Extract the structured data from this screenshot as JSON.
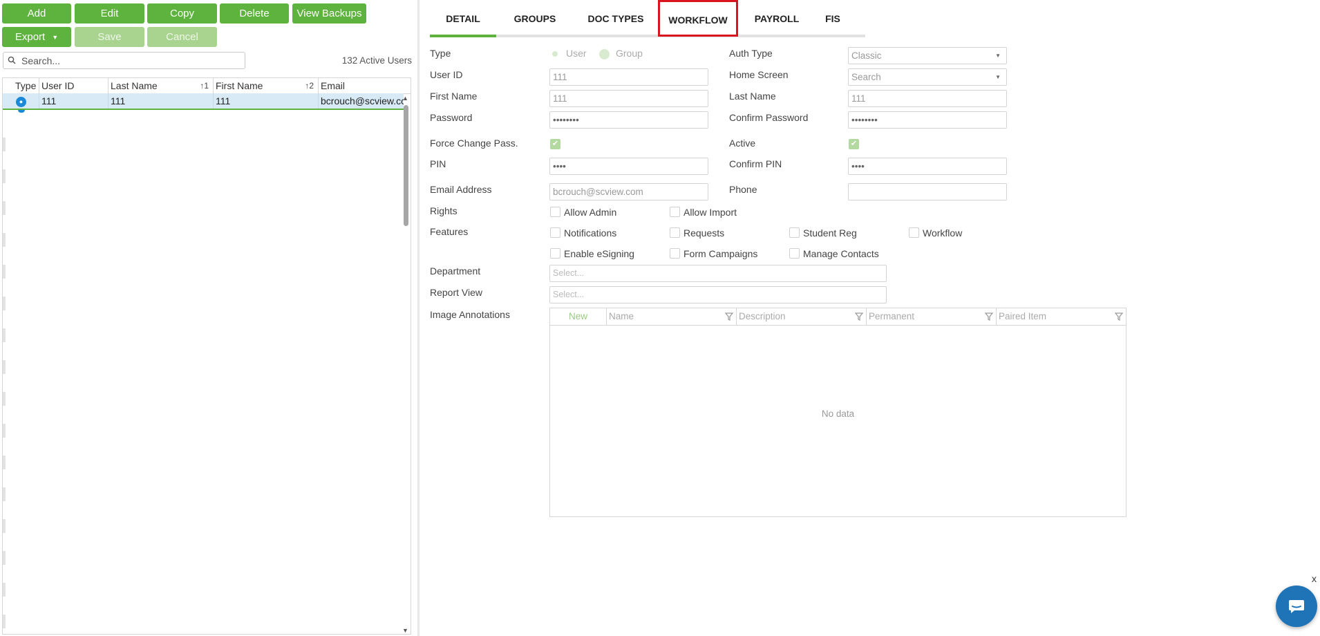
{
  "toolbar": {
    "add": "Add",
    "edit": "Edit",
    "copy": "Copy",
    "delete": "Delete",
    "view_backups": "View Backups",
    "export": "Export",
    "save": "Save",
    "cancel": "Cancel"
  },
  "search": {
    "placeholder": "Search..."
  },
  "active_users": "132 Active Users",
  "grid": {
    "columns": {
      "type": "Type",
      "user_id": "User ID",
      "last_name": "Last Name",
      "last_name_sort": "1",
      "first_name": "First Name",
      "first_name_sort": "2",
      "email": "Email"
    },
    "rows": [
      {
        "user_id": "111",
        "last_name": "111",
        "first_name": "111",
        "email": "bcrouch@scview.co"
      }
    ]
  },
  "tabs": {
    "detail": "DETAIL",
    "groups": "GROUPS",
    "doc_types": "DOC TYPES",
    "workflow": "WORKFLOW",
    "payroll": "PAYROLL",
    "fis": "FIS"
  },
  "form": {
    "type_label": "Type",
    "type_user": "User",
    "type_group": "Group",
    "auth_type_label": "Auth Type",
    "auth_type_value": "Classic",
    "user_id_label": "User ID",
    "user_id_value": "111",
    "home_screen_label": "Home Screen",
    "home_screen_value": "Search",
    "first_name_label": "First Name",
    "first_name_value": "111",
    "last_name_label": "Last Name",
    "last_name_value": "111",
    "password_label": "Password",
    "password_value": "••••••••",
    "confirm_password_label": "Confirm Password",
    "confirm_password_value": "••••••••",
    "force_change_label": "Force Change Pass.",
    "active_label": "Active",
    "pin_label": "PIN",
    "pin_value": "••••",
    "confirm_pin_label": "Confirm PIN",
    "confirm_pin_value": "••••",
    "email_label": "Email Address",
    "email_value": "bcrouch@scview.com",
    "phone_label": "Phone",
    "rights_label": "Rights",
    "allow_admin": "Allow Admin",
    "allow_import": "Allow Import",
    "features_label": "Features",
    "notifications": "Notifications",
    "requests": "Requests",
    "student_reg": "Student Reg",
    "workflow": "Workflow",
    "enable_esigning": "Enable eSigning",
    "form_campaigns": "Form Campaigns",
    "manage_contacts": "Manage Contacts",
    "department_label": "Department",
    "department_placeholder": "Select...",
    "report_view_label": "Report View",
    "report_view_placeholder": "Select...",
    "image_annotations_label": "Image Annotations"
  },
  "annotations": {
    "columns": {
      "new": "New",
      "name": "Name",
      "description": "Description",
      "permanent": "Permanent",
      "paired_item": "Paired Item"
    },
    "empty": "No data"
  },
  "chat": {
    "close": "x"
  },
  "colors": {
    "button_green": "#5db33d",
    "highlight_red": "#d9161e",
    "selected_row": "#d8eaf5",
    "chat_blue": "#1f73b7"
  },
  "icons": [
    "search-icon",
    "user-type-icon",
    "filter-icon",
    "chat-icon",
    "dropdown-caret-icon",
    "checkmark-icon"
  ]
}
